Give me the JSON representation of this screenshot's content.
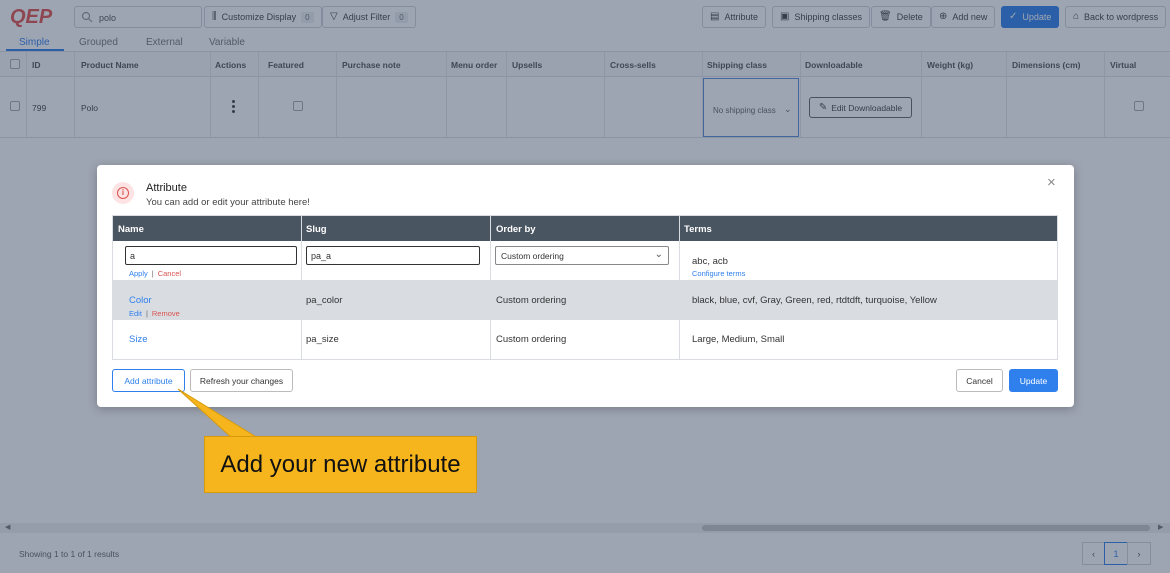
{
  "app": {
    "logo_text": "QEP",
    "search_value": "polo",
    "toolbar": {
      "customize_display": "Customize Display",
      "customize_count": "0",
      "adjust_filter": "Adjust Filter",
      "adjust_count": "0",
      "attribute": "Attribute",
      "shipping_classes": "Shipping classes",
      "delete": "Delete",
      "add_new": "Add new",
      "update": "Update",
      "back": "Back to wordpress"
    },
    "tabs": [
      "Simple",
      "Grouped",
      "External",
      "Variable"
    ],
    "columns": [
      "ID",
      "Product Name",
      "Actions",
      "Featured",
      "Purchase note",
      "Menu order",
      "Upsells",
      "Cross-sells",
      "Shipping class",
      "Downloadable",
      "Weight (kg)",
      "Dimensions (cm)",
      "Virtual"
    ],
    "row": {
      "id": "799",
      "name": "Polo",
      "shipping_class": "No shipping class",
      "downloadable_btn": "Edit Downloadable"
    },
    "footer": {
      "showing": "Showing 1 to 1 of 1 results",
      "page": "1",
      "prev": "‹",
      "next": "›"
    }
  },
  "modal": {
    "title": "Attribute",
    "subtitle": "You can add or edit your attribute here!",
    "close": "×",
    "headers": {
      "name": "Name",
      "slug": "Slug",
      "order_by": "Order by",
      "terms": "Terms"
    },
    "edit_row": {
      "name_value": "a",
      "slug_value": "pa_a",
      "order_value": "Custom ordering",
      "apply": "Apply",
      "cancel": "Cancel",
      "terms": "abc, acb",
      "configure_terms": "Configure terms"
    },
    "rows": [
      {
        "name": "Color",
        "edit": "Edit",
        "remove": "Remove",
        "slug": "pa_color",
        "order": "Custom ordering",
        "terms": "black, blue, cvf, Gray, Green, red, rtdtdft, turquoise, Yellow"
      },
      {
        "name": "Size",
        "slug": "pa_size",
        "order": "Custom ordering",
        "terms": "Large, Medium, Small"
      }
    ],
    "buttons": {
      "add_attribute": "Add attribute",
      "refresh": "Refresh your changes",
      "cancel": "Cancel",
      "update": "Update"
    }
  },
  "callout": {
    "text": "Add your new attribute",
    "color": "#f7b51d"
  },
  "colors": {
    "accent": "#2f80ed",
    "danger": "#d9534f",
    "table_header": "#4a5562",
    "overlay": "rgba(40,55,85,0.45)"
  }
}
